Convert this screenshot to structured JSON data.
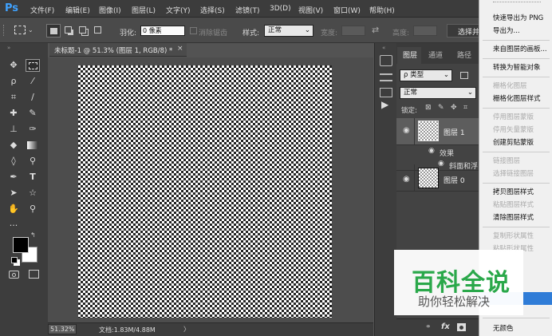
{
  "app": {
    "logo": "Ps"
  },
  "menu": [
    "文件(F)",
    "编辑(E)",
    "图像(I)",
    "图层(L)",
    "文字(Y)",
    "选择(S)",
    "滤镜(T)",
    "3D(D)",
    "视图(V)",
    "窗口(W)",
    "帮助(H)"
  ],
  "options": {
    "feather_label": "羽化:",
    "feather_value": "0 像素",
    "antialias_label": "消除锯齿",
    "style_label": "样式:",
    "style_value": "正常",
    "width_label": "宽度:",
    "height_label": "高度:",
    "select_mask_label": "选择并"
  },
  "document": {
    "tab_title": "未标题-1 @ 51.3% (图层 1, RGB/8) *",
    "zoom": "51.32%",
    "doc_info": "文档:1.83M/4.88M"
  },
  "layers_panel": {
    "tabs": [
      "图层",
      "通道",
      "路径"
    ],
    "filter_value": "ρ 类型",
    "blend_mode": "正常",
    "lock_label": "锁定:",
    "layers": [
      {
        "name": "图层 1",
        "effects_label": "效果",
        "effect_item": "斜面和浮"
      },
      {
        "name": "图层 0"
      }
    ]
  },
  "context_menu": {
    "items": [
      {
        "label": "快速导出为 PNG",
        "enabled": true
      },
      {
        "label": "导出为...",
        "enabled": true
      },
      {
        "label": "来自图层的画板...",
        "enabled": true
      },
      {
        "label": "转换为智能对象",
        "enabled": true
      },
      {
        "label": "栅格化图层",
        "enabled": false
      },
      {
        "label": "栅格化图层样式",
        "enabled": true
      },
      {
        "label": "停用图层蒙版",
        "enabled": false
      },
      {
        "label": "停用矢量蒙版",
        "enabled": false
      },
      {
        "label": "创建剪贴蒙版",
        "enabled": true
      },
      {
        "label": "链接图层",
        "enabled": false
      },
      {
        "label": "选择链接图层",
        "enabled": false
      },
      {
        "label": "拷贝图层样式",
        "enabled": true
      },
      {
        "label": "粘贴图层样式",
        "enabled": false
      },
      {
        "label": "清除图层样式",
        "enabled": true
      },
      {
        "label": "复制形状属性",
        "enabled": false
      },
      {
        "label": "粘贴形状属性",
        "enabled": false
      },
      {
        "label": "无颜色",
        "enabled": true
      }
    ]
  },
  "watermark": {
    "title": "百科全说",
    "subtitle": "助你轻松解决"
  },
  "colors": {
    "ps_blue": "#3fa2ff",
    "watermark_green": "#2aa84a",
    "highlight": "#2f7cd7"
  }
}
